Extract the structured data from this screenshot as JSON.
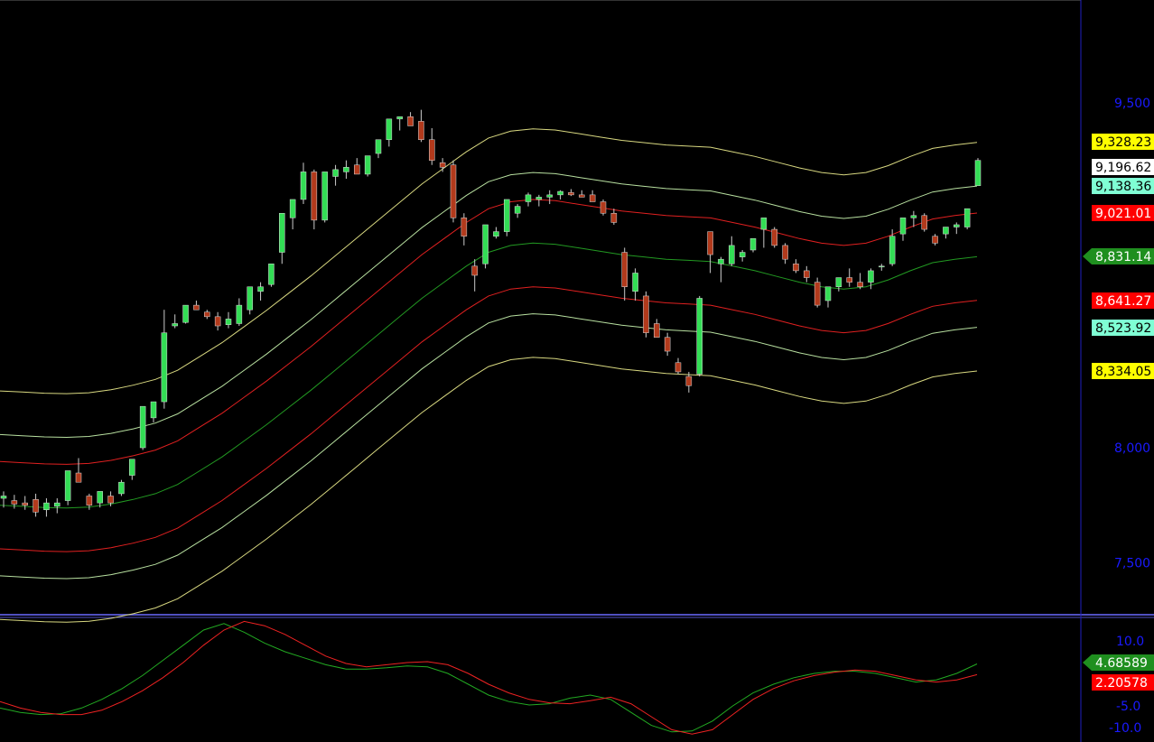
{
  "colors": {
    "background": "#000000",
    "axis_text": "#1a1aff",
    "separator": "#6a6aff",
    "axis_line": "#2020c0",
    "bull": "#33dd55",
    "bear": "#b23a1c",
    "band_outer": "#d8d880",
    "band_second": "#b8e0a0",
    "band_third": "#e02020",
    "ma_center": "#229922",
    "osc_green": "#22aa22",
    "osc_red": "#ee2222"
  },
  "chart_data": [
    {
      "type": "candlestick",
      "y_axis": {
        "ticks": [
          {
            "value": 9500,
            "label": "9,500"
          },
          {
            "value": 8000,
            "label": "8,000"
          },
          {
            "value": 7500,
            "label": "7,500"
          }
        ],
        "scale_labels": {
          "9500": 114,
          "8000": 496
        }
      },
      "value_tags": [
        {
          "label": "9,328.23",
          "value": 9328.23,
          "bg": "#ffff00",
          "fg": "#000000",
          "arrow": false
        },
        {
          "label": "9,196.62",
          "value": 9196.62,
          "bg": "#ffffff",
          "fg": "#000000",
          "arrow": false
        },
        {
          "label": "9,138.36",
          "value": 9138.36,
          "bg": "#7fffd4",
          "fg": "#000000",
          "arrow": false
        },
        {
          "label": "9,021.01",
          "value": 9021.01,
          "bg": "#ff0000",
          "fg": "#ffffff",
          "arrow": false
        },
        {
          "label": "8,831.14",
          "value": 8831.14,
          "bg": "#1f8f1f",
          "fg": "#ffffff",
          "arrow": true
        },
        {
          "label": "8,641.27",
          "value": 8641.27,
          "bg": "#ff0000",
          "fg": "#ffffff",
          "arrow": false
        },
        {
          "label": "8,523.92",
          "value": 8523.92,
          "bg": "#7fffd4",
          "fg": "#000000",
          "arrow": false
        },
        {
          "label": "8,334.05",
          "value": 8334.05,
          "bg": "#ffff00",
          "fg": "#000000",
          "arrow": false
        }
      ],
      "center_ma": [
        7750,
        7745,
        7740,
        7738,
        7742,
        7755,
        7775,
        7800,
        7840,
        7900,
        7960,
        8030,
        8100,
        8175,
        8250,
        8330,
        8410,
        8490,
        8570,
        8650,
        8720,
        8790,
        8850,
        8880,
        8890,
        8885,
        8870,
        8855,
        8840,
        8830,
        8820,
        8815,
        8810,
        8790,
        8770,
        8745,
        8720,
        8700,
        8690,
        8700,
        8730,
        8770,
        8805,
        8820,
        8831
      ],
      "band_offsets": {
        "outer": 497.09,
        "second": 307.26,
        "third": 189.87
      },
      "candles": [
        {
          "o": 7780,
          "h": 7810,
          "l": 7740,
          "c": 7790
        },
        {
          "o": 7770,
          "h": 7795,
          "l": 7735,
          "c": 7755
        },
        {
          "o": 7760,
          "h": 7790,
          "l": 7730,
          "c": 7750
        },
        {
          "o": 7775,
          "h": 7800,
          "l": 7700,
          "c": 7720
        },
        {
          "o": 7730,
          "h": 7780,
          "l": 7700,
          "c": 7760
        },
        {
          "o": 7745,
          "h": 7780,
          "l": 7715,
          "c": 7760
        },
        {
          "o": 7770,
          "h": 7830,
          "l": 7750,
          "c": 7900
        },
        {
          "o": 7890,
          "h": 7955,
          "l": 7855,
          "c": 7850
        },
        {
          "o": 7790,
          "h": 7800,
          "l": 7730,
          "c": 7750
        },
        {
          "o": 7760,
          "h": 7800,
          "l": 7740,
          "c": 7810
        },
        {
          "o": 7790,
          "h": 7810,
          "l": 7745,
          "c": 7760
        },
        {
          "o": 7800,
          "h": 7860,
          "l": 7790,
          "c": 7850
        },
        {
          "o": 7880,
          "h": 7890,
          "l": 7860,
          "c": 7950
        },
        {
          "o": 8000,
          "h": 8030,
          "l": 7990,
          "c": 8180
        },
        {
          "o": 8130,
          "h": 8200,
          "l": 8110,
          "c": 8200
        },
        {
          "o": 8200,
          "h": 8600,
          "l": 8170,
          "c": 8500
        },
        {
          "o": 8530,
          "h": 8580,
          "l": 8520,
          "c": 8540
        },
        {
          "o": 8545,
          "h": 8620,
          "l": 8540,
          "c": 8620
        },
        {
          "o": 8620,
          "h": 8640,
          "l": 8600,
          "c": 8600
        },
        {
          "o": 8590,
          "h": 8600,
          "l": 8560,
          "c": 8570
        },
        {
          "o": 8570,
          "h": 8590,
          "l": 8510,
          "c": 8530
        },
        {
          "o": 8535,
          "h": 8590,
          "l": 8520,
          "c": 8560
        },
        {
          "o": 8540,
          "h": 8650,
          "l": 8530,
          "c": 8620
        },
        {
          "o": 8600,
          "h": 8660,
          "l": 8580,
          "c": 8700
        },
        {
          "o": 8680,
          "h": 8720,
          "l": 8640,
          "c": 8700
        },
        {
          "o": 8710,
          "h": 8790,
          "l": 8700,
          "c": 8800
        },
        {
          "o": 8850,
          "h": 8960,
          "l": 8800,
          "c": 9020
        },
        {
          "o": 9000,
          "h": 9070,
          "l": 8950,
          "c": 9080
        },
        {
          "o": 9080,
          "h": 9240,
          "l": 9060,
          "c": 9200
        },
        {
          "o": 9200,
          "h": 9210,
          "l": 8950,
          "c": 8990
        },
        {
          "o": 8990,
          "h": 9200,
          "l": 8980,
          "c": 9200
        },
        {
          "o": 9180,
          "h": 9230,
          "l": 9140,
          "c": 9210
        },
        {
          "o": 9200,
          "h": 9250,
          "l": 9170,
          "c": 9220
        },
        {
          "o": 9230,
          "h": 9260,
          "l": 9200,
          "c": 9190
        },
        {
          "o": 9190,
          "h": 9250,
          "l": 9180,
          "c": 9270
        },
        {
          "o": 9280,
          "h": 9310,
          "l": 9260,
          "c": 9340
        },
        {
          "o": 9340,
          "h": 9420,
          "l": 9310,
          "c": 9430
        },
        {
          "o": 9430,
          "h": 9440,
          "l": 9380,
          "c": 9440
        },
        {
          "o": 9440,
          "h": 9460,
          "l": 9400,
          "c": 9400
        },
        {
          "o": 9420,
          "h": 9470,
          "l": 9330,
          "c": 9340
        },
        {
          "o": 9340,
          "h": 9390,
          "l": 9230,
          "c": 9250
        },
        {
          "o": 9240,
          "h": 9260,
          "l": 9200,
          "c": 9220
        },
        {
          "o": 9230,
          "h": 9250,
          "l": 8980,
          "c": 9000
        },
        {
          "o": 9000,
          "h": 9020,
          "l": 8880,
          "c": 8920
        },
        {
          "o": 8790,
          "h": 8820,
          "l": 8680,
          "c": 8750
        },
        {
          "o": 8800,
          "h": 8950,
          "l": 8780,
          "c": 8970
        },
        {
          "o": 8920,
          "h": 8960,
          "l": 8910,
          "c": 8940
        },
        {
          "o": 8940,
          "h": 8990,
          "l": 8920,
          "c": 9080
        }
      ],
      "candles_2": [
        {
          "o": 9020,
          "h": 9060,
          "l": 9000,
          "c": 9050
        },
        {
          "o": 9070,
          "h": 9110,
          "l": 9050,
          "c": 9100
        },
        {
          "o": 9080,
          "h": 9100,
          "l": 9050,
          "c": 9090
        },
        {
          "o": 9090,
          "h": 9120,
          "l": 9060,
          "c": 9100
        },
        {
          "o": 9100,
          "h": 9120,
          "l": 9080,
          "c": 9115
        },
        {
          "o": 9110,
          "h": 9125,
          "l": 9095,
          "c": 9100
        },
        {
          "o": 9100,
          "h": 9120,
          "l": 9090,
          "c": 9090
        },
        {
          "o": 9100,
          "h": 9120,
          "l": 9080,
          "c": 9070
        },
        {
          "o": 9070,
          "h": 9080,
          "l": 9010,
          "c": 9020
        },
        {
          "o": 9020,
          "h": 9040,
          "l": 8970,
          "c": 8980
        },
        {
          "o": 8850,
          "h": 8870,
          "l": 8640,
          "c": 8700
        },
        {
          "o": 8680,
          "h": 8780,
          "l": 8640,
          "c": 8760
        },
        {
          "o": 8660,
          "h": 8680,
          "l": 8480,
          "c": 8500
        },
        {
          "o": 8540,
          "h": 8560,
          "l": 8480,
          "c": 8480
        },
        {
          "o": 8480,
          "h": 8500,
          "l": 8400,
          "c": 8420
        },
        {
          "o": 8370,
          "h": 8390,
          "l": 8320,
          "c": 8330
        },
        {
          "o": 8310,
          "h": 8330,
          "l": 8240,
          "c": 8270
        },
        {
          "o": 8320,
          "h": 8660,
          "l": 8310,
          "c": 8650
        },
        {
          "o": 8940,
          "h": 8940,
          "l": 8760,
          "c": 8840
        },
        {
          "o": 8800,
          "h": 8830,
          "l": 8720,
          "c": 8820
        },
        {
          "o": 8800,
          "h": 8920,
          "l": 8790,
          "c": 8880
        },
        {
          "o": 8830,
          "h": 8860,
          "l": 8810,
          "c": 8850
        },
        {
          "o": 8860,
          "h": 8900,
          "l": 8850,
          "c": 8910
        },
        {
          "o": 8950,
          "h": 8960,
          "l": 8870,
          "c": 9000
        },
        {
          "o": 8950,
          "h": 8960,
          "l": 8870,
          "c": 8880
        },
        {
          "o": 8880,
          "h": 8890,
          "l": 8800,
          "c": 8820
        },
        {
          "o": 8800,
          "h": 8820,
          "l": 8760,
          "c": 8770
        },
        {
          "o": 8770,
          "h": 8790,
          "l": 8720,
          "c": 8740
        },
        {
          "o": 8720,
          "h": 8740,
          "l": 8610,
          "c": 8620
        },
        {
          "o": 8640,
          "h": 8700,
          "l": 8610,
          "c": 8700
        },
        {
          "o": 8700,
          "h": 8740,
          "l": 8680,
          "c": 8740
        },
        {
          "o": 8740,
          "h": 8780,
          "l": 8700,
          "c": 8720
        },
        {
          "o": 8720,
          "h": 8760,
          "l": 8690,
          "c": 8700
        },
        {
          "o": 8720,
          "h": 8780,
          "l": 8690,
          "c": 8770
        },
        {
          "o": 8790,
          "h": 8800,
          "l": 8770,
          "c": 8790
        },
        {
          "o": 8800,
          "h": 8950,
          "l": 8790,
          "c": 8920
        },
        {
          "o": 8930,
          "h": 9000,
          "l": 8900,
          "c": 9000
        },
        {
          "o": 9000,
          "h": 9030,
          "l": 8960,
          "c": 9010
        },
        {
          "o": 9010,
          "h": 9020,
          "l": 8940,
          "c": 8950
        },
        {
          "o": 8920,
          "h": 8930,
          "l": 8880,
          "c": 8890
        },
        {
          "o": 8930,
          "h": 8960,
          "l": 8910,
          "c": 8960
        },
        {
          "o": 8960,
          "h": 8980,
          "l": 8930,
          "c": 8970
        },
        {
          "o": 8960,
          "h": 9040,
          "l": 8950,
          "c": 9040
        },
        {
          "o": 9140,
          "h": 9260,
          "l": 9140,
          "c": 9250
        }
      ]
    },
    {
      "type": "line",
      "y_axis": {
        "ticks": [
          {
            "value": 10,
            "label": "10.0"
          },
          {
            "value": -5,
            "label": "-5.0"
          },
          {
            "value": -10,
            "label": "-10.0"
          }
        ]
      },
      "value_tags": [
        {
          "label": "4.68589",
          "value": 4.68589,
          "bg": "#1f8f1f",
          "fg": "#ffffff",
          "arrow": true
        },
        {
          "label": "2.20578",
          "value": 2.20578,
          "bg": "#ff0000",
          "fg": "#ffffff",
          "arrow": false
        }
      ],
      "series": [
        {
          "color_key": "osc_green",
          "values": [
            -5.5,
            -6.5,
            -7.0,
            -6.8,
            -5.5,
            -3.5,
            -1.0,
            2.0,
            5.5,
            9.0,
            12.5,
            14.0,
            12.0,
            9.5,
            7.5,
            6.0,
            4.5,
            3.5,
            3.5,
            3.8,
            4.2,
            4.0,
            2.5,
            0.0,
            -2.5,
            -4.0,
            -4.8,
            -4.5,
            -3.2,
            -2.5,
            -3.5,
            -6.5,
            -9.5,
            -11.0,
            -10.8,
            -8.5,
            -5.0,
            -2.0,
            0.0,
            1.5,
            2.5,
            3.0,
            3.0,
            2.5,
            1.5,
            0.5,
            1.0,
            2.5,
            4.68589
          ]
        },
        {
          "color_key": "osc_red",
          "values": [
            -4.0,
            -5.5,
            -6.5,
            -7.0,
            -7.0,
            -6.0,
            -4.0,
            -1.5,
            1.5,
            5.0,
            9.0,
            12.5,
            14.5,
            13.5,
            11.5,
            9.0,
            6.5,
            4.8,
            4.0,
            4.5,
            5.0,
            5.2,
            4.5,
            2.5,
            0.0,
            -2.0,
            -3.5,
            -4.3,
            -4.5,
            -3.8,
            -3.0,
            -4.5,
            -7.5,
            -10.5,
            -11.5,
            -10.5,
            -7.0,
            -3.5,
            -1.0,
            0.8,
            2.0,
            2.8,
            3.3,
            3.0,
            2.0,
            1.0,
            0.5,
            1.0,
            2.20578
          ]
        }
      ]
    }
  ]
}
